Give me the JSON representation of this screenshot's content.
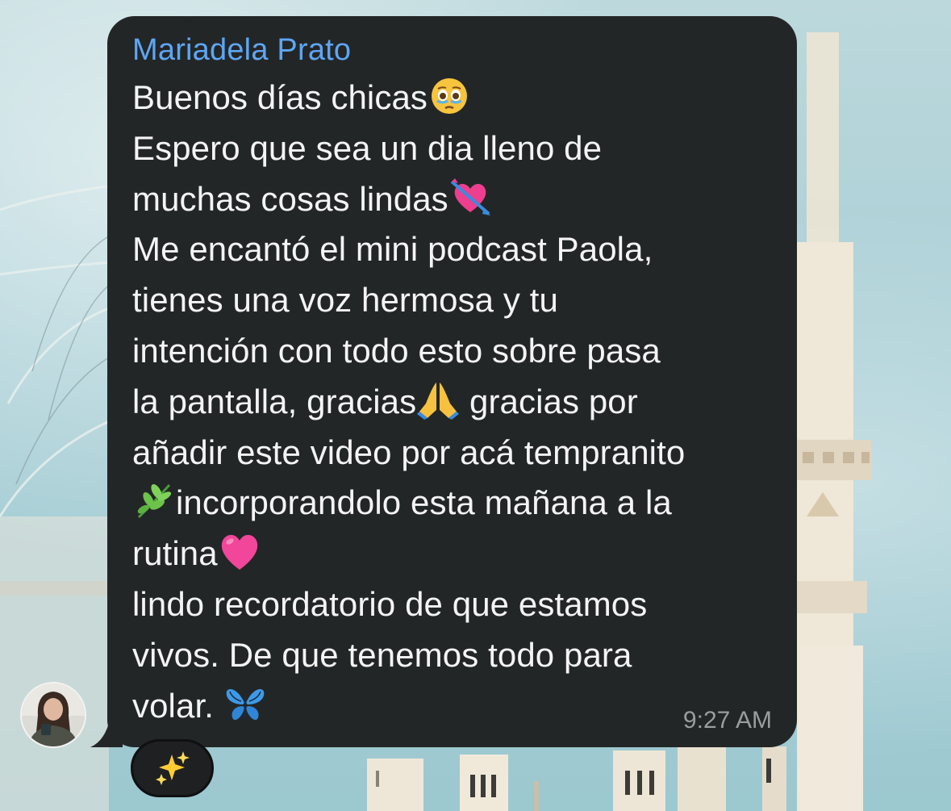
{
  "message": {
    "sender": "Mariadela Prato",
    "lines": [
      {
        "text": "Buenos días chicas",
        "emoji": "face-holding-back-tears-emoji"
      },
      {
        "text": "Espero que sea un dia lleno de",
        "emoji": ""
      },
      {
        "text": "muchas cosas lindas",
        "emoji": "heart-with-arrow-emoji"
      },
      {
        "text": "Me encantó el mini podcast Paola,",
        "emoji": ""
      },
      {
        "text": "tienes una voz hermosa y tu",
        "emoji": ""
      },
      {
        "text": "intención con todo esto sobre pasa",
        "emoji": ""
      },
      {
        "text": "la pantalla, gracias",
        "emoji": "folded-hands-emoji",
        "after": " gracias por"
      },
      {
        "text": "añadir este video por acá tempranito",
        "emoji": ""
      },
      {
        "pre_emoji": "herb-emoji",
        "text": "incorporandolo esta mañana a la"
      },
      {
        "text": "rutina",
        "emoji": "pink-heart-emoji"
      },
      {
        "text": "lindo recordatorio de que estamos",
        "emoji": ""
      },
      {
        "text": "vivos. De que tenemos todo para",
        "emoji": ""
      },
      {
        "text": "volar. ",
        "emoji": "butterfly-emoji"
      }
    ],
    "time": "9:27 AM"
  },
  "reaction": {
    "emoji": "sparkles-emoji"
  },
  "avatar": {
    "icon": "profile-photo-avatar"
  },
  "colors": {
    "bubble": "#232627",
    "sender": "#5ea6f3",
    "text": "#f4f4f4",
    "timestamp": "#9a9c9e"
  }
}
